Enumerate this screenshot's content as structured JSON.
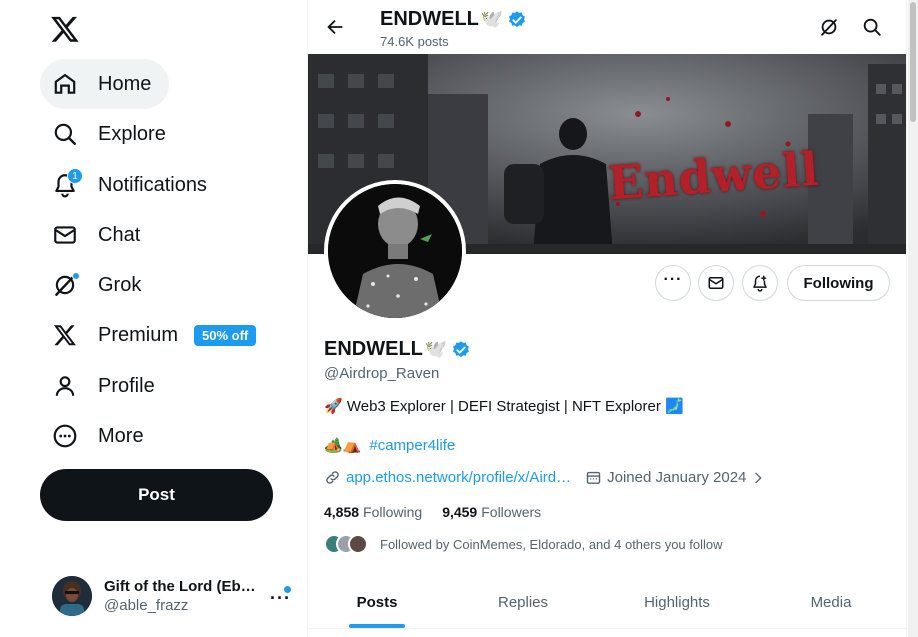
{
  "sidebar": {
    "logo_icon": "x-logo-icon",
    "nav": [
      {
        "label": "Home",
        "icon": "home-icon"
      },
      {
        "label": "Explore",
        "icon": "search-icon"
      },
      {
        "label": "Notifications",
        "icon": "bell-icon",
        "badge": "1"
      },
      {
        "label": "Chat",
        "icon": "envelope-icon"
      },
      {
        "label": "Grok",
        "icon": "grok-icon"
      },
      {
        "label": "Premium",
        "icon": "x-logo-icon",
        "pill": "50% off"
      },
      {
        "label": "Profile",
        "icon": "person-icon"
      },
      {
        "label": "More",
        "icon": "more-circle-icon"
      }
    ],
    "post_label": "Post",
    "account": {
      "name": "Gift of the Lord (Eb…",
      "handle": "@able_frazz"
    }
  },
  "header": {
    "name": "ENDWELL",
    "name_emoji": "🕊️",
    "posts_count": "74.6K posts"
  },
  "banner": {
    "text": "Endwell"
  },
  "profile": {
    "name": "ENDWELL",
    "name_emoji": "🕊️",
    "handle": "@Airdrop_Raven",
    "bio": "🚀 Web3 Explorer | DEFI Strategist | NFT Explorer 🗾",
    "tag_emojis": "🏕️⛺",
    "hashtag": "#camper4life",
    "link": "app.ethos.network/profile/x/Aird…",
    "joined": "Joined January 2024",
    "following_count": "4,858",
    "following_label": "Following",
    "followers_count": "9,459",
    "followers_label": "Followers",
    "followed_by": "Followed by CoinMemes, Eldorado, and 4 others you follow",
    "follow_button": "Following"
  },
  "tabs": [
    "Posts",
    "Replies",
    "Highlights",
    "Media"
  ],
  "colors": {
    "accent": "#1d9bf0",
    "text": "#0f1419",
    "muted": "#536471"
  }
}
